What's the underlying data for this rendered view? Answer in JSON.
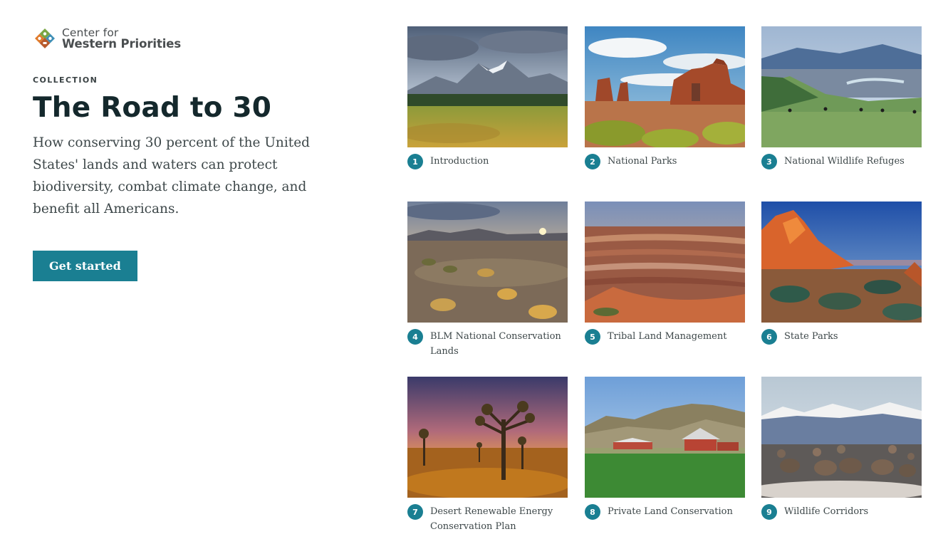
{
  "brand": {
    "line1": "Center for",
    "line2": "Western Priorities"
  },
  "eyebrow": "COLLECTION",
  "title": "The Road to 30",
  "description": "How conserving 30 percent of the United States' lands and waters can protect biodiversity, combat climate change, and benefit all Americans.",
  "cta_label": "Get started",
  "colors": {
    "accent": "#1a7f92",
    "heading": "#14282c",
    "body": "#3d4749"
  },
  "cards": [
    {
      "number": "1",
      "label": "Introduction",
      "image": "mountain-meadow-landscape"
    },
    {
      "number": "2",
      "label": "National Parks",
      "image": "red-rock-arches-landscape"
    },
    {
      "number": "3",
      "label": "National Wildlife Refuges",
      "image": "green-valley-bison-landscape"
    },
    {
      "number": "4",
      "label": "BLM National Conservation Lands",
      "image": "desert-sunset-sagebrush"
    },
    {
      "number": "5",
      "label": "Tribal Land Management",
      "image": "layered-canyon-landscape"
    },
    {
      "number": "6",
      "label": "State Parks",
      "image": "red-rock-formation-sky"
    },
    {
      "number": "7",
      "label": "Desert Renewable Energy Conservation Plan",
      "image": "joshua-tree-dusk"
    },
    {
      "number": "8",
      "label": "Private Land Conservation",
      "image": "ranch-barn-green-field"
    },
    {
      "number": "9",
      "label": "Wildlife Corridors",
      "image": "mule-deer-snowy-mountains"
    }
  ]
}
